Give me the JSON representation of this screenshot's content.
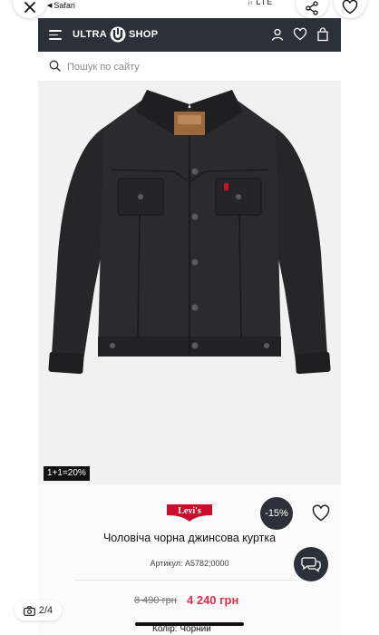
{
  "browser": {
    "back_label": "Safari",
    "signal_text": "ᵢₗ LTE"
  },
  "header": {
    "logo_left": "ULTRA",
    "logo_right": "SHOP"
  },
  "search": {
    "placeholder": "Пошук по сайту"
  },
  "product": {
    "promo_badge": "1+1=20%",
    "brand": "Levi's",
    "discount": "-15%",
    "title": "Чоловіча чорна джинсова куртка",
    "sku_label": "Артикул:",
    "sku_value": "A5782;0000",
    "old_price": "8 490 грн",
    "new_price": "4 240 грн",
    "color_label": "Колір:",
    "color_value": "Чорний"
  },
  "gallery": {
    "counter": "2/4"
  },
  "colors": {
    "header_bg": "#2c3038",
    "price_red": "#e3304a",
    "levis_red": "#c8102e"
  }
}
